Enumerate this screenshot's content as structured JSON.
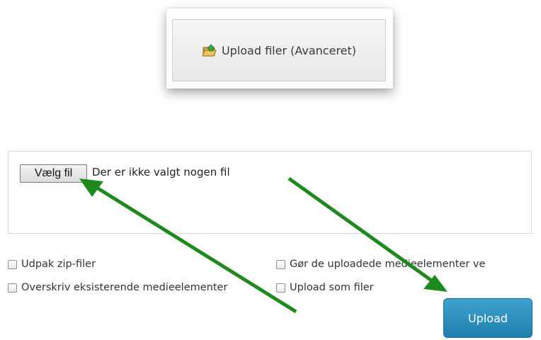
{
  "advanced_button": {
    "label": "Upload filer (Avanceret)",
    "icon": "upload-folder-icon"
  },
  "file_picker": {
    "button_label": "Vælg fil",
    "status_text": "Der er ikke valgt nogen fil"
  },
  "options": {
    "unzip_label": "Udpak zip-filer",
    "overwrite_label": "Overskriv eksisterende medieelementer",
    "public_label": "Gør de uploadede medieelementer ve",
    "as_files_label": "Upload som filer"
  },
  "upload_button": {
    "label": "Upload"
  },
  "colors": {
    "arrow": "#1e8a1e",
    "upload_button": "#2a8fc0"
  }
}
